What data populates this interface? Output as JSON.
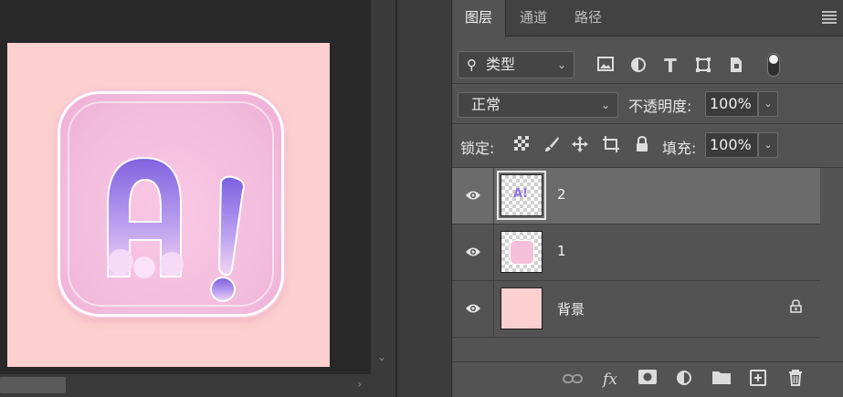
{
  "panel": {
    "tabs": [
      {
        "label": "图层",
        "active": true
      },
      {
        "label": "通道",
        "active": false
      },
      {
        "label": "路径",
        "active": false
      }
    ],
    "filter": {
      "kind_label": "类型",
      "icons": [
        "image-filter-icon",
        "adjustment-filter-icon",
        "type-filter-icon",
        "shape-filter-icon",
        "smart-object-filter-icon",
        "filter-toggle"
      ]
    },
    "blend_mode": "正常",
    "opacity_label": "不透明度:",
    "opacity_value": "100%",
    "lock_label": "锁定:",
    "lock_icons": [
      "lock-transparent-icon",
      "lock-image-icon",
      "lock-position-icon",
      "lock-artboard-icon",
      "lock-all-icon"
    ],
    "fill_label": "填充:",
    "fill_value": "100%",
    "layers": [
      {
        "name": "2",
        "selected": true,
        "visible": true,
        "thumb_text": "A!"
      },
      {
        "name": "1",
        "selected": false,
        "visible": true
      },
      {
        "name": "背景",
        "selected": false,
        "visible": true,
        "locked": true
      }
    ],
    "bottom_icons": [
      "link-layers-icon",
      "fx-icon",
      "add-mask-icon",
      "new-adjustment-icon",
      "new-group-icon",
      "new-layer-icon",
      "delete-layer-icon"
    ],
    "fx_label": "fx"
  },
  "canvas": {
    "artwork_text": "A!",
    "background_color": "#fcd0cf"
  },
  "colors": {
    "panel_bg": "#535353",
    "selected_layer": "#6b6b6b",
    "canvas_bg": "#282828"
  }
}
